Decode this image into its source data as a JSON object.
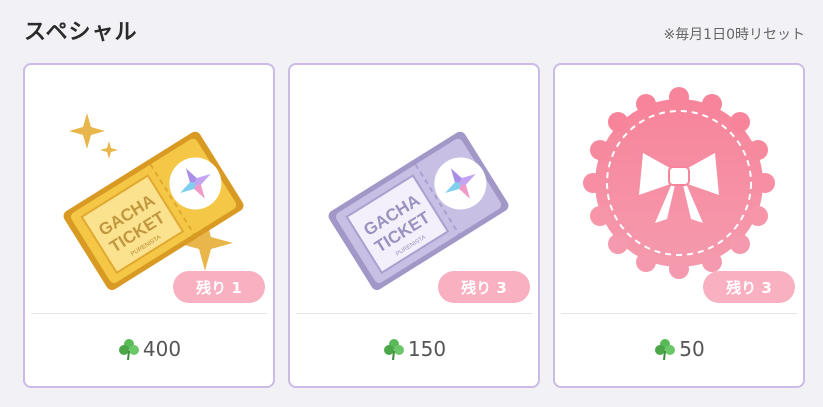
{
  "header": {
    "title": "スペシャル",
    "reset_note": "※毎月1日0時リセット"
  },
  "items": [
    {
      "ticket_text_1": "GACHA",
      "ticket_text_2": "TICKET",
      "brand": "PURENISTA",
      "remaining": "残り 1",
      "price": "400",
      "color": "#f2b93a"
    },
    {
      "ticket_text_1": "GACHA",
      "ticket_text_2": "TICKET",
      "brand": "PURENISTA",
      "remaining": "残り 3",
      "price": "150",
      "color": "#b9aed8"
    },
    {
      "remaining": "残り 3",
      "price": "50",
      "color": "#f6889f"
    }
  ],
  "icons": {
    "currency": "clover-icon"
  }
}
